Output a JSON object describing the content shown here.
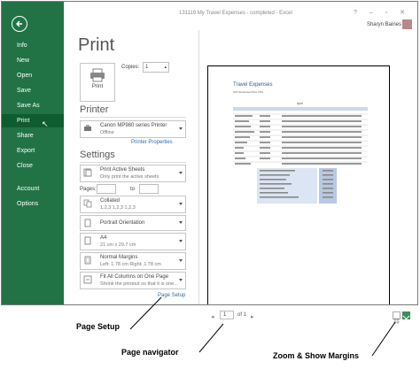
{
  "window": {
    "title": "131119 My Travel Expenses - completed - Excel",
    "user_name": "Sharyn Baines",
    "controls": "? – ▫ ✕"
  },
  "sidebar": {
    "items": [
      {
        "label": "Info"
      },
      {
        "label": "New"
      },
      {
        "label": "Open"
      },
      {
        "label": "Save"
      },
      {
        "label": "Save As"
      },
      {
        "label": "Print"
      },
      {
        "label": "Share"
      },
      {
        "label": "Export"
      },
      {
        "label": "Close"
      },
      {
        "label": "Account"
      },
      {
        "label": "Options"
      }
    ],
    "active": "Print"
  },
  "print": {
    "heading": "Print",
    "button_label": "Print",
    "copies_label": "Copies:",
    "copies_value": "1"
  },
  "printer": {
    "section_title": "Printer",
    "name": "Canon MP980 series Printer",
    "status": "Offline",
    "properties_link": "Printer Properties"
  },
  "settings": {
    "section_title": "Settings",
    "active_sheets_main": "Print Active Sheets",
    "active_sheets_sub": "Only print the active sheets",
    "pages_label": "Pages:",
    "to_label": "to",
    "collated_main": "Collated",
    "collated_sub": "1,2,3    1,2,3    1,2,3",
    "orientation_main": "Portrait Orientation",
    "paper_main": "A4",
    "paper_sub": "21 cm x 29.7 cm",
    "margins_main": "Normal Margins",
    "margins_sub": "Left: 1.78 cm    Right: 1.78 cm",
    "scaling_main": "Fit All Columns on One Page",
    "scaling_sub": "Shrink the printout so that it is one...",
    "page_setup_link": "Page Setup"
  },
  "preview": {
    "doc_title": "Travel Expenses",
    "doc_sub": "GST Exclusive Price         15%",
    "month": "April"
  },
  "navigator": {
    "page_value": "1",
    "of_label": "of 1"
  },
  "callouts": {
    "page_setup": "Page Setup",
    "page_navigator": "Page navigator",
    "zoom_margins": "Zoom & Show Margins"
  },
  "colors": {
    "sidebar_green": "#217346",
    "sidebar_active": "#0e5c2f",
    "doc_title_blue": "#2f5597",
    "link_blue": "#2a6fb0"
  }
}
